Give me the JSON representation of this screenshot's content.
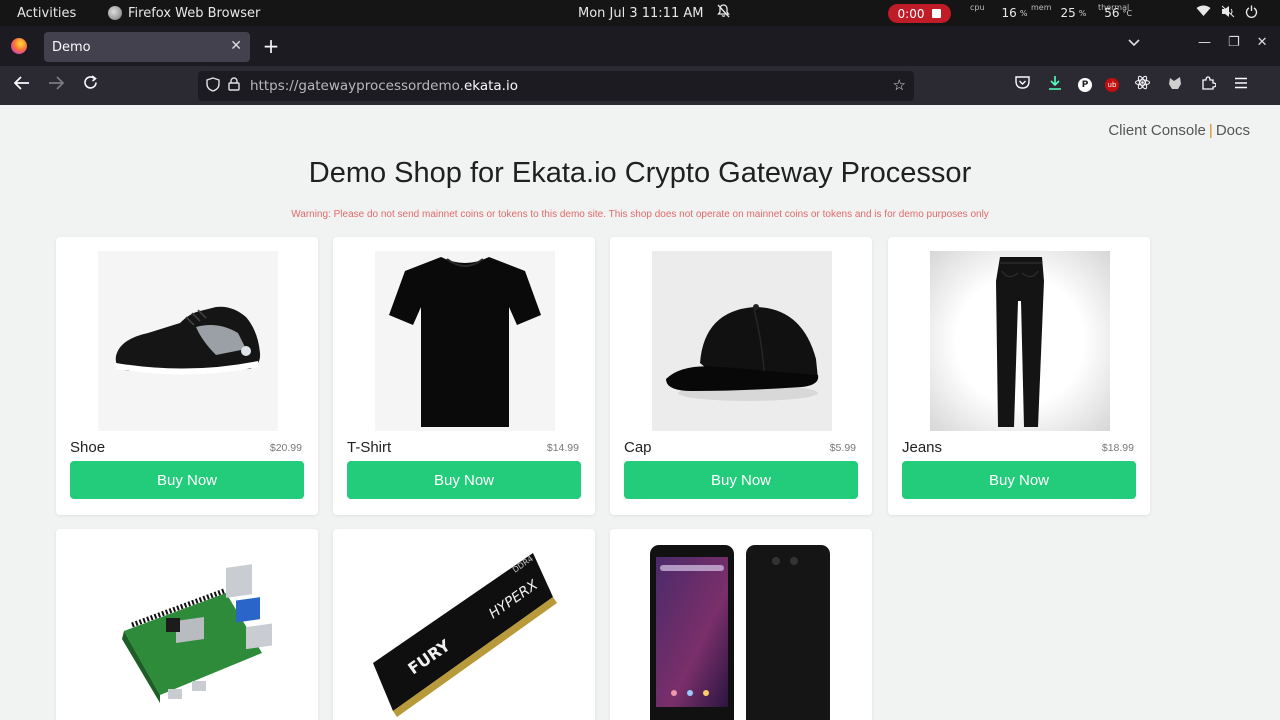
{
  "topbar": {
    "activities": "Activities",
    "app_name": "Firefox Web Browser",
    "clock": "Mon Jul 3  11:11 AM",
    "recording": "0:00",
    "cpu_label": "cpu",
    "cpu_value": "16",
    "mem_label": "mem",
    "mem_value": "25",
    "thermal_label": "thermal",
    "thermal_value": "56",
    "percent": "%",
    "celsius": "°C"
  },
  "browser": {
    "tab_title": "Demo",
    "url_prefix": "https://gatewayprocessordemo.",
    "url_domain": "ekata.io"
  },
  "page": {
    "client_console": "Client Console",
    "separator": "|",
    "docs": "Docs",
    "title": "Demo Shop for Ekata.io Crypto Gateway Processor",
    "warning": "Warning: Please do not send mainnet coins or tokens to this demo site. This shop does not operate on mainnet coins or tokens and is for demo purposes only"
  },
  "products": [
    {
      "name": "Shoe",
      "price": "$20.99",
      "button": "Buy Now",
      "image": "shoe"
    },
    {
      "name": "T-Shirt",
      "price": "$14.99",
      "button": "Buy Now",
      "image": "tshirt"
    },
    {
      "name": "Cap",
      "price": "$5.99",
      "button": "Buy Now",
      "image": "cap"
    },
    {
      "name": "Jeans",
      "price": "$18.99",
      "button": "Buy Now",
      "image": "jeans"
    },
    {
      "image": "raspberry-pi"
    },
    {
      "image": "ram-stick",
      "image_text": [
        "FURY",
        "HYPERX",
        "DDR4"
      ]
    },
    {
      "image": "smartphones"
    }
  ],
  "colors": {
    "buy_button": "#23cc7a",
    "warning": "#e06a6a",
    "recording": "#c01c28"
  }
}
